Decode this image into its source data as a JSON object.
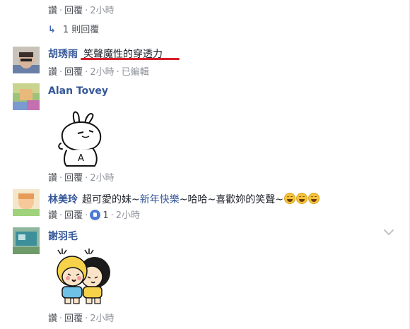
{
  "actions": {
    "like": "讚",
    "reply": "回覆",
    "dot": "·",
    "edited": "已編輯"
  },
  "colors": {
    "name": "#365899",
    "action": "#4b4f56",
    "meta": "#90949c",
    "underline": "#d6202a",
    "like_badge": "#4e7bd6"
  },
  "top": {
    "time": "2小時"
  },
  "replies_link": {
    "arrow": "↳",
    "label": "1 則回覆"
  },
  "comments": [
    {
      "name": "胡琇雨",
      "text": "笑聲魔性的穿透力",
      "time": "2小時",
      "edited": true,
      "avatar_icon": "avatar-photo-icon"
    },
    {
      "name": "Alan Tovey",
      "text": "",
      "time": "2小時",
      "sticker_icon": "rabbit-sticker-icon",
      "sticker_text": "A",
      "avatar_icon": "avatar-photo-icon"
    },
    {
      "name": "林美玲",
      "text_before": "超可愛的妹~",
      "tag": "新年快樂",
      "text_after": "~哈哈~喜歡妳的笑聲~",
      "emoji_count": 3,
      "emoji_icon": "grinning-face-icon",
      "likes": "1",
      "time": "2小時",
      "avatar_icon": "avatar-photo-icon"
    },
    {
      "name": "謝羽毛",
      "text": "",
      "time": "2小時",
      "sticker_icon": "two-kids-sticker-icon",
      "avatar_icon": "avatar-photo-icon",
      "menu_icon": "chevron-down-icon"
    }
  ]
}
